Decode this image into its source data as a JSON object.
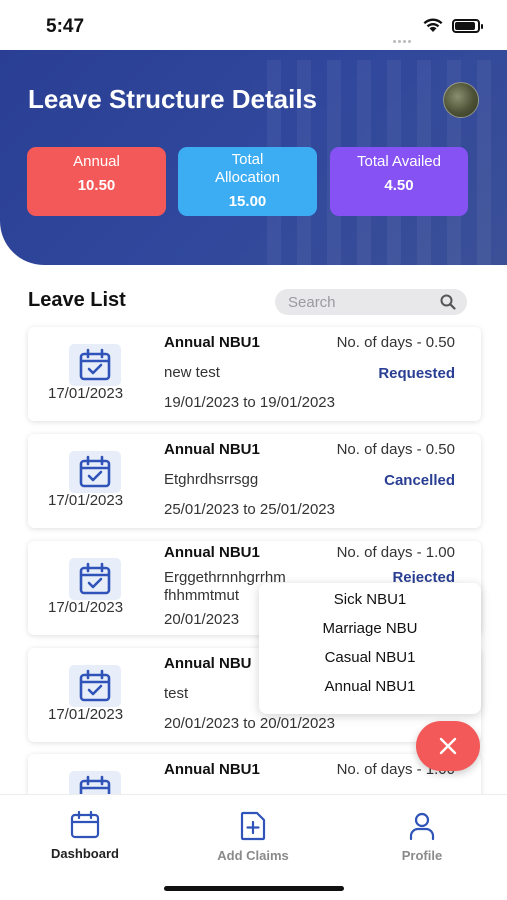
{
  "status_bar": {
    "time": "5:47"
  },
  "header": {
    "title": "Leave Structure Details",
    "stats": [
      {
        "label": "Annual",
        "value": "10.50",
        "color": "#f35958"
      },
      {
        "label": "Total Allocation",
        "value": "15.00",
        "color": "#3dadf3"
      },
      {
        "label": "Total Availed",
        "value": "4.50",
        "color": "#8752f4"
      }
    ]
  },
  "leave_list": {
    "title": "Leave List",
    "search_placeholder": "Search",
    "items": [
      {
        "applied_date": "17/01/2023",
        "type": "Annual NBU1",
        "days": "No. of days - 0.50",
        "reason": "new test",
        "status": "Requested",
        "range": "19/01/2023 to 19/01/2023"
      },
      {
        "applied_date": "17/01/2023",
        "type": "Annual NBU1",
        "days": "No. of days - 0.50",
        "reason": "Etghrdhsrrsgg",
        "status": "Cancelled",
        "range": "25/01/2023 to 25/01/2023"
      },
      {
        "applied_date": "17/01/2023",
        "type": "Annual NBU1",
        "days": "No. of days - 1.00",
        "reason": "Erggethrnnhgrrhm fhhmmtmut",
        "status": "Rejected",
        "range": "20/01/2023"
      },
      {
        "applied_date": "17/01/2023",
        "type": "Annual NBU",
        "days": "",
        "reason": "test",
        "status": "",
        "range": "20/01/2023 to 20/01/2023"
      },
      {
        "applied_date": "",
        "type": "Annual NBU1",
        "days": "No. of days - 1.00",
        "reason": "",
        "status": "",
        "range": ""
      }
    ]
  },
  "leave_type_menu": {
    "options": [
      "Sick NBU1",
      "Marriage NBU",
      "Casual NBU1",
      "Annual NBU1"
    ]
  },
  "fab": {
    "icon": "close-icon"
  },
  "tabbar": {
    "tabs": [
      {
        "label": "Dashboard",
        "icon": "calendar-icon",
        "active": true
      },
      {
        "label": "Add Claims",
        "icon": "add-document-icon",
        "active": false
      },
      {
        "label": "Profile",
        "icon": "user-icon",
        "active": false
      }
    ]
  },
  "colors": {
    "primary": "#2a3f93",
    "accent_red": "#f35958",
    "accent_blue": "#3dadf3",
    "accent_purple": "#8752f4"
  }
}
